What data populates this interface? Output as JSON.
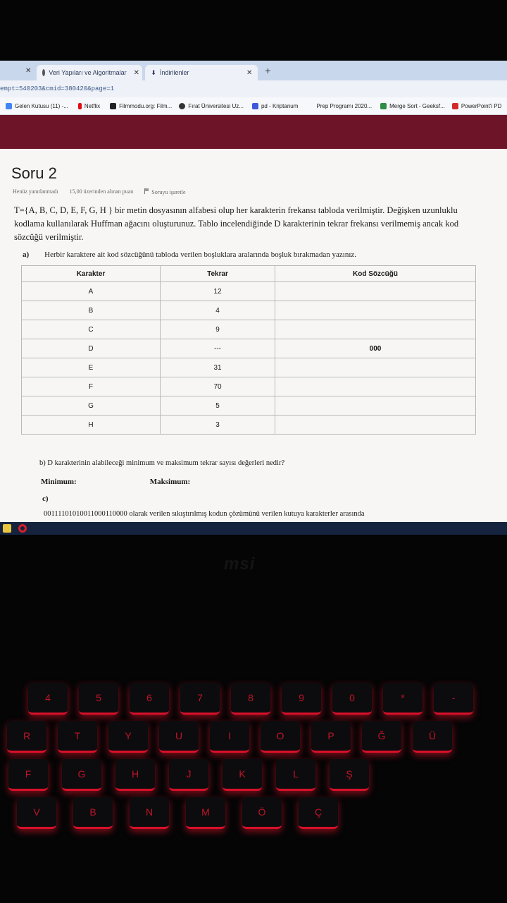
{
  "browser": {
    "tabs": [
      {
        "label": "Veri Yapıları ve Algoritmalar",
        "icon": "globe-icon"
      },
      {
        "label": "İndirilenler",
        "icon": "download-icon"
      }
    ],
    "address": "empt=540203&cmid=380420&page=1",
    "bookmarks": [
      {
        "label": "Gelen Kutusu (11) -...",
        "icon": "google-icon",
        "color": "#4285f4"
      },
      {
        "label": "Netflix",
        "icon": "netflix-icon",
        "color": "#e50914"
      },
      {
        "label": "Filmmodu.org: Film...",
        "icon": "film-icon",
        "color": "#222222"
      },
      {
        "label": "Fırat Üniversitesi Uz...",
        "icon": "globe-icon",
        "color": "#333333"
      },
      {
        "label": "pd - Kriptanum",
        "icon": "w-icon",
        "color": "#3b5bdb"
      },
      {
        "label": "Prep Programı 2020...",
        "icon": "",
        "color": ""
      },
      {
        "label": "Merge Sort - Geeksf...",
        "icon": "gg-icon",
        "color": "#2f8d46"
      },
      {
        "label": "PowerPoint'i PD",
        "icon": "pdf-icon",
        "color": "#d12a2a"
      }
    ]
  },
  "question": {
    "title": "Soru 2",
    "status": "Henüz yanıtlanmadı",
    "points": "15,00 üzerinden alınan puan",
    "flag": "Soruyu işaretle",
    "text": "T={A, B, C, D, E, F, G, H } bir metin dosyasının alfabesi olup her karakterin frekansı tabloda verilmiştir. Değişken uzunluklu kodlama kullanılarak Huffman ağacını oluşturunuz. Tablo incelendiğinde D karakterinin tekrar frekansı verilmemiş ancak kod sözcüğü verilmiştir.",
    "part_a_label": "a)",
    "part_a_text": "Herbir karaktere ait kod sözcüğünü tabloda verilen boşluklara aralarında boşluk bırakmadan yazınız.",
    "table": {
      "headers": [
        "Karakter",
        "Tekrar",
        "Kod Sözcüğü"
      ],
      "rows": [
        {
          "char": "A",
          "freq": "12",
          "code": ""
        },
        {
          "char": "B",
          "freq": "4",
          "code": ""
        },
        {
          "char": "C",
          "freq": "9",
          "code": ""
        },
        {
          "char": "D",
          "freq": "---",
          "code": "000"
        },
        {
          "char": "E",
          "freq": "31",
          "code": ""
        },
        {
          "char": "F",
          "freq": "70",
          "code": ""
        },
        {
          "char": "G",
          "freq": "5",
          "code": ""
        },
        {
          "char": "H",
          "freq": "3",
          "code": ""
        }
      ]
    },
    "part_b": "b) D karakterinin alabileceği minimum ve maksimum tekrar sayısı değerleri nedir?",
    "min_label": "Minimum:",
    "max_label": "Maksimum:",
    "part_c_label": "c)",
    "part_c_text": "00111101010011000110000 olarak verilen sıkıştırılmış kodun çözümünü verilen kutuya karakterler arasında"
  },
  "laptop": {
    "brand": "msi",
    "keys": [
      "4",
      "5",
      "6",
      "7",
      "8",
      "9",
      "0",
      "*",
      "-",
      "R",
      "T",
      "Y",
      "U",
      "I",
      "O",
      "P",
      "Ğ",
      "Ü",
      "F",
      "G",
      "H",
      "J",
      "K",
      "L",
      "Ş",
      "V",
      "B",
      "N",
      "M",
      "Ö",
      "Ç"
    ]
  }
}
